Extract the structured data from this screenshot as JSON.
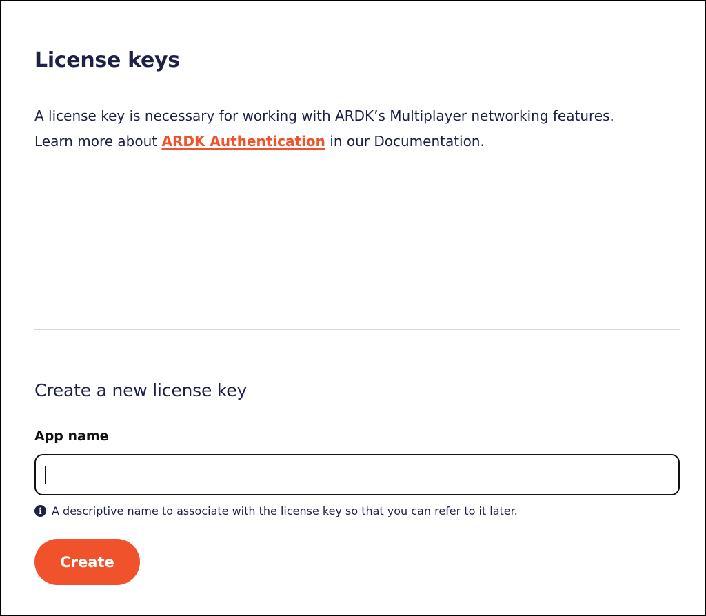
{
  "page": {
    "title": "License keys",
    "intro_line1": "A license key is necessary for working with ARDK’s Multiplayer networking features.",
    "intro_line2_before": "Learn more about ",
    "intro_link": "ARDK Authentication",
    "intro_line2_after": " in our Documentation."
  },
  "create_section": {
    "title": "Create a new license key",
    "field_label": "App name",
    "field_value": "",
    "field_placeholder": "",
    "hint": "A descriptive name to associate with the license key so that you can refer to it later.",
    "button_label": "Create"
  },
  "icons": {
    "info": "info-icon"
  },
  "colors": {
    "accent": "#f0532c",
    "text": "#1c2145"
  }
}
